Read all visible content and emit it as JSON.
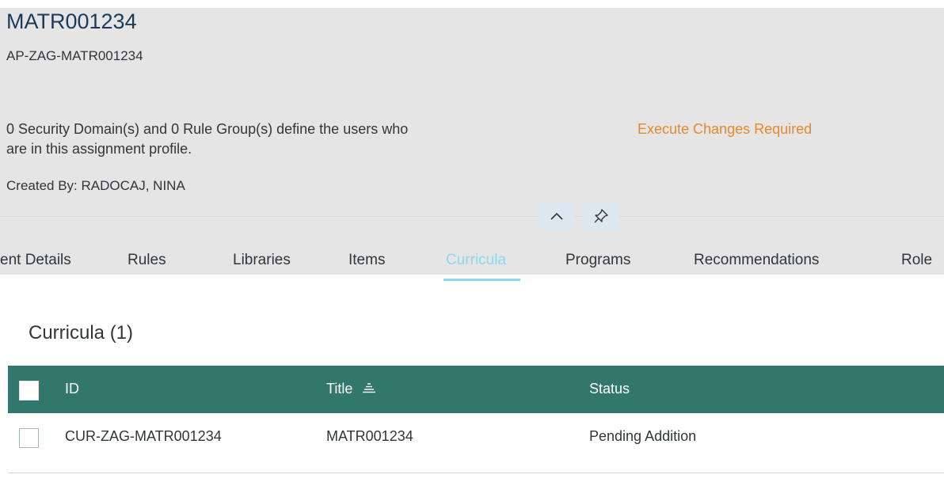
{
  "header": {
    "title": "MATR001234",
    "subtitle": "AP-ZAG-MATR001234",
    "description_line1": "0 Security Domain(s) and 0 Rule Group(s) define the users who",
    "description_line2": "are in this assignment profile.",
    "execute_link": "Execute Changes Required",
    "created_by": "Created By: RADOCAJ, NINA",
    "collapse_icon": "chevron-up-icon",
    "pin_icon": "pin-icon",
    "accent_color": "#e9882a"
  },
  "tabs": [
    {
      "label": "ent Details"
    },
    {
      "label": "Rules"
    },
    {
      "label": "Libraries"
    },
    {
      "label": "Items"
    },
    {
      "label": "Curricula",
      "active": true
    },
    {
      "label": "Programs"
    },
    {
      "label": "Recommendations"
    },
    {
      "label": "Role"
    }
  ],
  "section": {
    "title": "Curricula (1)"
  },
  "table": {
    "header_color": "#32776b",
    "columns": [
      "ID",
      "Title",
      "Status"
    ],
    "sort_icon": "sort-icon",
    "rows": [
      {
        "id": "CUR-ZAG-MATR001234",
        "title": "MATR001234",
        "status": "Pending Addition",
        "selected": false
      }
    ]
  }
}
